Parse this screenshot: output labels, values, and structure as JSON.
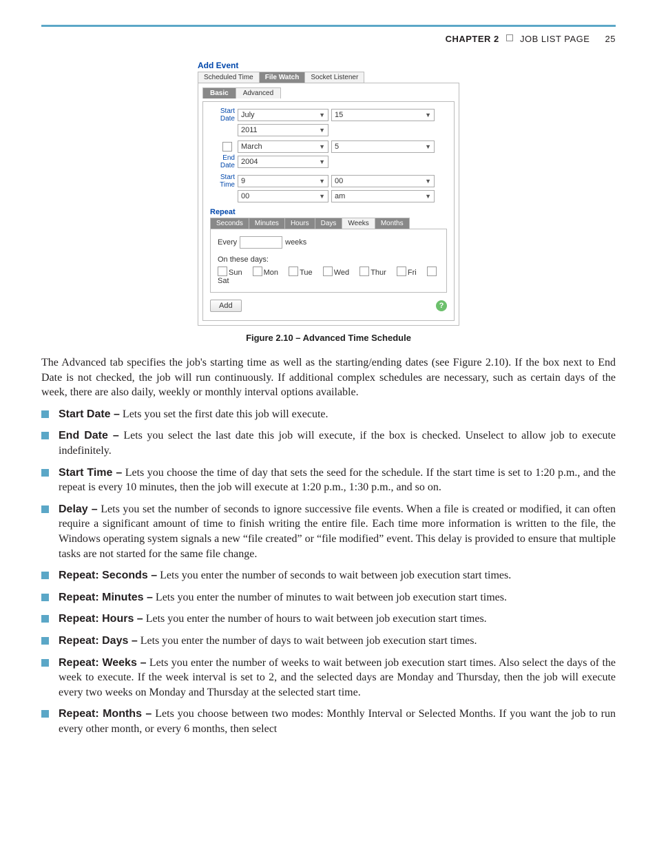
{
  "header": {
    "chapter_label": "CHAPTER 2",
    "section_title": "JOB LIST PAGE",
    "page_number": "25"
  },
  "dialog": {
    "title": "Add Event",
    "outer_tabs": [
      "Scheduled Time",
      "File Watch",
      "Socket Listener"
    ],
    "outer_active_index": 1,
    "inner_tabs": [
      "Basic",
      "Advanced"
    ],
    "inner_active_index": 0,
    "start_date_label": "Start Date",
    "start_month": "July",
    "start_day": "15",
    "start_year": "2011",
    "end_date_label": "End Date",
    "end_month": "March",
    "end_day": "5",
    "end_year": "2004",
    "start_time_label": "Start Time",
    "start_hour": "9",
    "start_min": "00",
    "start_sec": "00",
    "ampm": "am",
    "repeat_label": "Repeat",
    "repeat_tabs": [
      "Seconds",
      "Minutes",
      "Hours",
      "Days",
      "Weeks",
      "Months"
    ],
    "repeat_active_index": 4,
    "every_label": "Every",
    "weeks_suffix": "weeks",
    "days_header": "On these days:",
    "days": [
      "Sun",
      "Mon",
      "Tue",
      "Wed",
      "Thur",
      "Fri",
      "Sat"
    ],
    "add_button": "Add",
    "help": "?"
  },
  "figcaption": "Figure 2.10 – Advanced Time Schedule",
  "intro_para": "The Advanced tab specifies the job's starting time as well as the starting/ending dates (see Figure 2.10). If the box next to End Date is not checked, the job will run continuously. If additional complex schedules are necessary, such as certain days of the week, there are also daily, weekly or monthly interval options available.",
  "items": [
    {
      "term": "Start Date –",
      "text": " Lets you set the first date this job will execute."
    },
    {
      "term": "End Date –",
      "text": " Lets you select the last date this job will execute, if the box is checked. Unselect to allow job to execute indefinitely."
    },
    {
      "term": "Start Time –",
      "text": " Lets you choose the time of day that sets the seed for the schedule. If the start time is set to 1:20 p.m., and the repeat is every 10 minutes, then the job will execute at 1:20 p.m., 1:30 p.m., and so on."
    },
    {
      "term": "Delay –",
      "text": " Lets you set the number of seconds to ignore successive file events. When a file is created or modified, it can often require a significant amount of time to finish writing the entire file. Each time more information is written to the file, the Windows operating system signals a new “file created” or “file modified” event. This delay is provided to ensure that multiple tasks are not started for the same file change."
    },
    {
      "term": "Repeat: Seconds –",
      "text": " Lets you enter the number of seconds to wait between job execution start times."
    },
    {
      "term": "Repeat: Minutes –",
      "text": " Lets you enter the number of minutes to wait between job execution start times."
    },
    {
      "term": "Repeat: Hours –",
      "text": " Lets you enter the number of hours to wait between job execution start times."
    },
    {
      "term": "Repeat: Days –",
      "text": " Lets you enter the number of days to wait between job execution start times."
    },
    {
      "term": "Repeat: Weeks –",
      "text": " Lets you enter the number of weeks to wait between job execution start times. Also select the days of the week to execute. If the week interval is set to 2, and the selected days are Monday and Thursday, then the job will execute every two weeks on Monday and Thursday at the selected start time."
    },
    {
      "term": "Repeat: Months –",
      "text": " Lets you choose between two modes: Monthly Interval or Selected Months. If you want the job to run every other month, or every 6 months, then select"
    }
  ]
}
